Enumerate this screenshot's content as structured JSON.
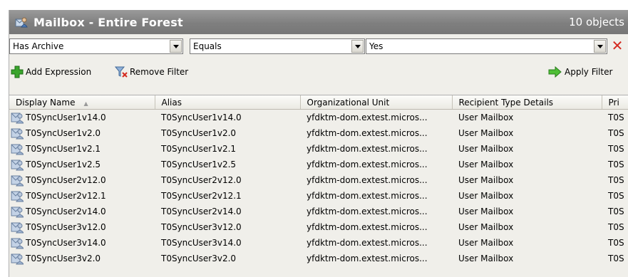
{
  "header": {
    "title": "Mailbox - Entire Forest",
    "count": "10 objects"
  },
  "filter": {
    "attribute": "Has Archive",
    "operator": "Equals",
    "value": "Yes"
  },
  "toolbar": {
    "add_expression": "Add Expression",
    "remove_filter": "Remove Filter",
    "apply_filter": "Apply Filter"
  },
  "table": {
    "columns": [
      "Display Name",
      "Alias",
      "Organizational Unit",
      "Recipient Type Details",
      "Pri"
    ],
    "rows": [
      [
        "T0SyncUser1v14.0",
        "T0SyncUser1v14.0",
        "yfdktm-dom.extest.micros...",
        "User Mailbox",
        "T0S"
      ],
      [
        "T0SyncUser1v2.0",
        "T0SyncUser1v2.0",
        "yfdktm-dom.extest.micros...",
        "User Mailbox",
        "T0S"
      ],
      [
        "T0SyncUser1v2.1",
        "T0SyncUser1v2.1",
        "yfdktm-dom.extest.micros...",
        "User Mailbox",
        "T0S"
      ],
      [
        "T0SyncUser1v2.5",
        "T0SyncUser1v2.5",
        "yfdktm-dom.extest.micros...",
        "User Mailbox",
        "T0S"
      ],
      [
        "T0SyncUser2v12.0",
        "T0SyncUser2v12.0",
        "yfdktm-dom.extest.micros...",
        "User Mailbox",
        "T0S"
      ],
      [
        "T0SyncUser2v12.1",
        "T0SyncUser2v12.1",
        "yfdktm-dom.extest.micros...",
        "User Mailbox",
        "T0S"
      ],
      [
        "T0SyncUser2v14.0",
        "T0SyncUser2v14.0",
        "yfdktm-dom.extest.micros...",
        "User Mailbox",
        "T0S"
      ],
      [
        "T0SyncUser3v12.0",
        "T0SyncUser3v12.0",
        "yfdktm-dom.extest.micros...",
        "User Mailbox",
        "T0S"
      ],
      [
        "T0SyncUser3v14.0",
        "T0SyncUser3v14.0",
        "yfdktm-dom.extest.micros...",
        "User Mailbox",
        "T0S"
      ],
      [
        "T0SyncUser3v2.0",
        "T0SyncUser3v2.0",
        "yfdktm-dom.extest.micros...",
        "User Mailbox",
        "T0S"
      ]
    ]
  },
  "icons": {
    "title": "mailbox-icon",
    "add": "green-plus-icon",
    "remove": "funnel-remove-icon",
    "apply": "green-arrow-icon",
    "clear": "red-x-icon",
    "row": "mailbox-user-icon"
  },
  "colors": {
    "titlebar": "#888888",
    "add_green": "#3aa52c",
    "clear_red": "#d42a20"
  }
}
